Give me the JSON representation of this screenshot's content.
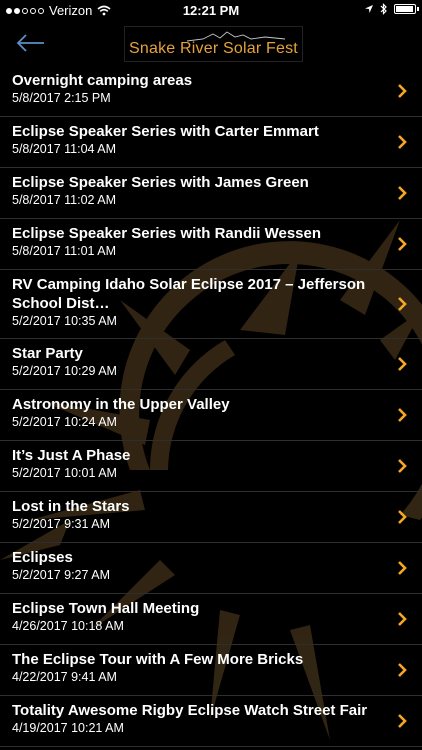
{
  "status_bar": {
    "carrier": "Verizon",
    "time": "12:21 PM",
    "signal_icons": [
      "signal-dots-icon",
      "wifi-icon",
      "location-arrow-icon",
      "bluetooth-icon",
      "battery-icon"
    ]
  },
  "header": {
    "back_icon": "back-arrow-icon",
    "logo_text": "Snake River Solar Fest"
  },
  "colors": {
    "accent": "#f5a623",
    "background": "#000000",
    "logo_text": "#e6a23a"
  },
  "items": [
    {
      "title": "Overnight camping areas",
      "date": "5/8/2017 2:15 PM"
    },
    {
      "title": "Eclipse Speaker Series with Carter Emmart",
      "date": "5/8/2017 11:04 AM"
    },
    {
      "title": "Eclipse Speaker Series with James Green",
      "date": "5/8/2017 11:02 AM"
    },
    {
      "title": "Eclipse Speaker Series with Randii Wessen",
      "date": "5/8/2017 11:01 AM"
    },
    {
      "title": "RV Camping Idaho Solar Eclipse 2017 – Jefferson School Dist…",
      "date": "5/2/2017 10:35 AM"
    },
    {
      "title": "Star Party",
      "date": "5/2/2017 10:29 AM"
    },
    {
      "title": "Astronomy in the Upper Valley",
      "date": "5/2/2017 10:24 AM"
    },
    {
      "title": "It’s Just A Phase",
      "date": "5/2/2017 10:01 AM"
    },
    {
      "title": "Lost in the Stars",
      "date": "5/2/2017 9:31 AM"
    },
    {
      "title": "Eclipses",
      "date": "5/2/2017 9:27 AM"
    },
    {
      "title": "Eclipse Town Hall Meeting",
      "date": "4/26/2017 10:18 AM"
    },
    {
      "title": "The Eclipse Tour with A Few More Bricks",
      "date": "4/22/2017 9:41 AM"
    },
    {
      "title": "Totality Awesome Rigby Eclipse Watch Street Fair",
      "date": "4/19/2017 10:21 AM"
    }
  ]
}
